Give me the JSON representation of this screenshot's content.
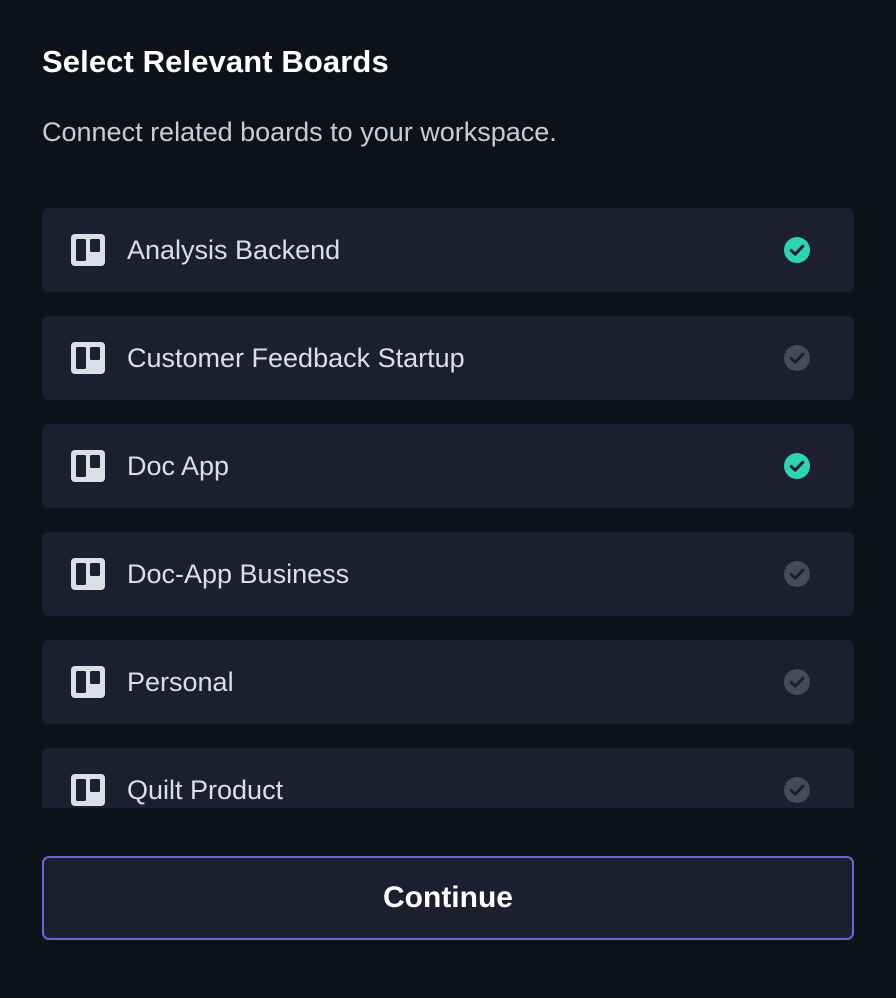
{
  "header": {
    "title": "Select Relevant Boards",
    "subtitle": "Connect related boards to your workspace."
  },
  "boards": [
    {
      "label": "Analysis Backend",
      "selected": true
    },
    {
      "label": "Customer Feedback Startup",
      "selected": false
    },
    {
      "label": "Doc App",
      "selected": true
    },
    {
      "label": "Doc-App Business",
      "selected": false
    },
    {
      "label": "Personal",
      "selected": false
    },
    {
      "label": "Quilt Product",
      "selected": false
    }
  ],
  "footer": {
    "continue_label": "Continue"
  },
  "colors": {
    "background": "#0f111a",
    "item_background": "#1d1f30",
    "check_selected": "#2dd4b0",
    "check_unselected": "#474a5a",
    "button_border": "#6c63d9"
  },
  "icons": {
    "board": "board-icon",
    "check": "check-circle-icon"
  }
}
